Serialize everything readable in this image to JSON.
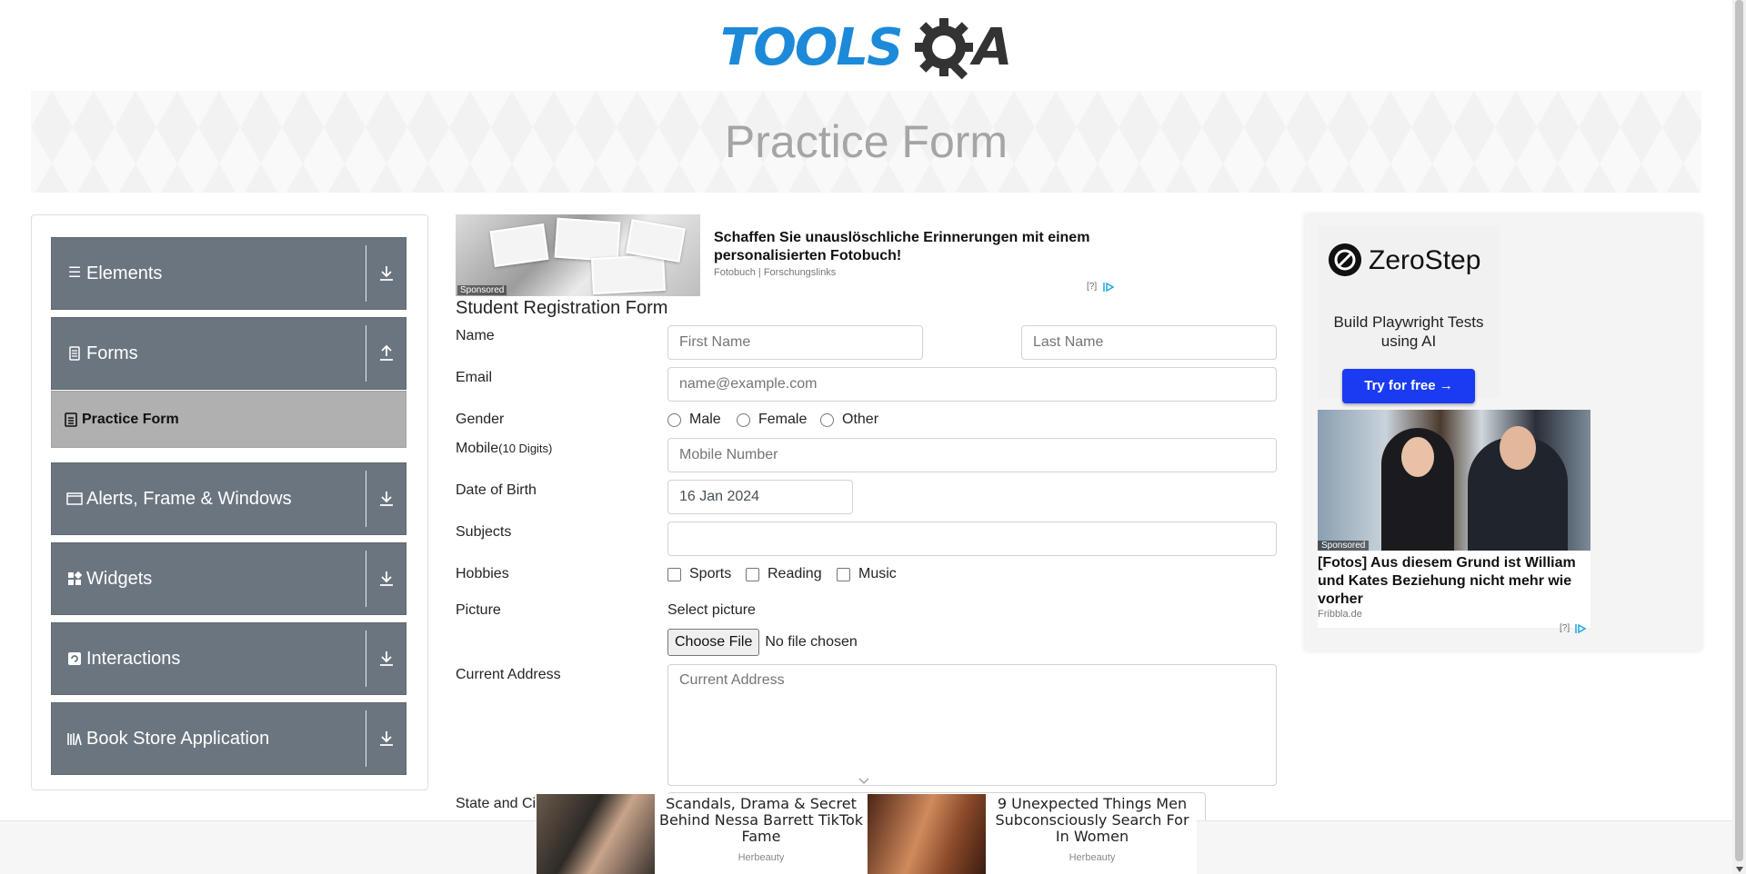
{
  "header": {
    "logo_tools": "TOOLS",
    "logo_a": "A",
    "page_title": "Practice Form"
  },
  "sidebar": {
    "groups": [
      {
        "label": "Elements",
        "icon": "list-icon",
        "expanded": false
      },
      {
        "label": "Forms",
        "icon": "form-icon",
        "expanded": true
      },
      {
        "label": "Alerts, Frame & Windows",
        "icon": "window-icon",
        "expanded": false
      },
      {
        "label": "Widgets",
        "icon": "widgets-icon",
        "expanded": false
      },
      {
        "label": "Interactions",
        "icon": "interactions-icon",
        "expanded": false
      },
      {
        "label": "Book Store Application",
        "icon": "books-icon",
        "expanded": false
      }
    ],
    "active_item": {
      "label": "Practice Form",
      "icon": "form-small-icon"
    }
  },
  "ad_top": {
    "sponsored": "Sponsored",
    "headline": "Schaffen Sie unauslöschliche Erinnerungen mit einem personalisierten Fotobuch!",
    "source": "Fotobuch | Forschungslinks",
    "info": "[?]"
  },
  "form": {
    "title": "Student Registration Form",
    "labels": {
      "name": "Name",
      "email": "Email",
      "gender": "Gender",
      "mobile": "Mobile",
      "mobile_hint": "(10 Digits)",
      "dob": "Date of Birth",
      "subjects": "Subjects",
      "hobbies": "Hobbies",
      "picture": "Picture",
      "address": "Current Address",
      "state": "State and Ci"
    },
    "placeholders": {
      "first_name": "First Name",
      "last_name": "Last Name",
      "email": "name@example.com",
      "mobile": "Mobile Number",
      "address": "Current Address"
    },
    "values": {
      "dob": "16 Jan 2024",
      "subjects": ""
    },
    "genders": [
      "Male",
      "Female",
      "Other"
    ],
    "hobbies": [
      "Sports",
      "Reading",
      "Music"
    ],
    "picture": {
      "select_label": "Select picture",
      "button": "Choose File",
      "status": "No file chosen"
    }
  },
  "ad_right": {
    "brand": "ZeroStep",
    "tagline": "Build Playwright Tests using AI",
    "cta": "Try for free →",
    "sponsored": "Sponsored",
    "headline": "[Fotos] Aus diesem Grund ist William und Kates Beziehung nicht mehr wie vorher",
    "source": "Fribbla.de",
    "info": "[?]"
  },
  "bottom_ads": [
    {
      "text": "Scandals, Drama & Secret Behind Nessa Barrett TikTok Fame",
      "source": "Herbeauty"
    },
    {
      "text": "9 Unexpected Things Men Subconsciously Search For In Women",
      "source": "Herbeauty"
    }
  ],
  "colors": {
    "sidebar_group": "#6b7580",
    "active_item": "#b0b0b0",
    "logo_blue": "#1c8ad8",
    "cta_blue": "#1a3bf1"
  }
}
